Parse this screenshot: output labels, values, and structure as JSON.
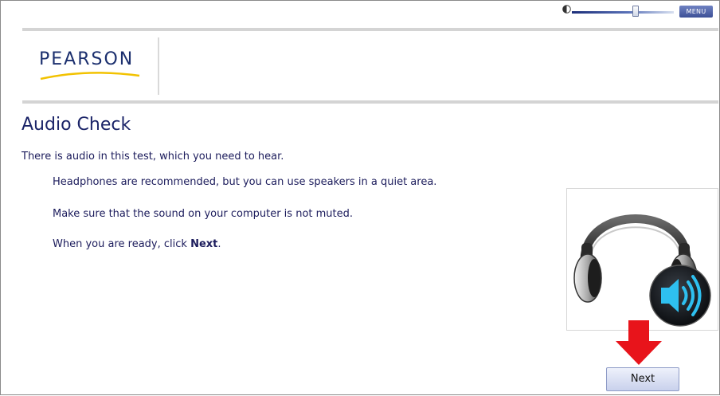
{
  "header": {
    "menu_label": "MENU",
    "volume_level": 0.6,
    "icons": [
      "volume-icon"
    ]
  },
  "brand": {
    "logo_text": "PEARSON"
  },
  "main": {
    "title": "Audio Check",
    "intro": "There is audio in this test, which you need to hear.",
    "lines": [
      "Headphones are recommended, but you can use speakers in a quiet area.",
      "Make sure that the sound on your computer is not muted."
    ],
    "ready_prefix": "When you are ready, click ",
    "ready_bold": "Next",
    "ready_suffix": "."
  },
  "illustration": {
    "icons": [
      "headphones-icon",
      "speaker-icon",
      "red-down-arrow-icon"
    ]
  },
  "footer": {
    "next_label": "Next"
  },
  "colors": {
    "accent": "#3c4f96",
    "arrow": "#e8141b",
    "title": "#1b2468"
  }
}
